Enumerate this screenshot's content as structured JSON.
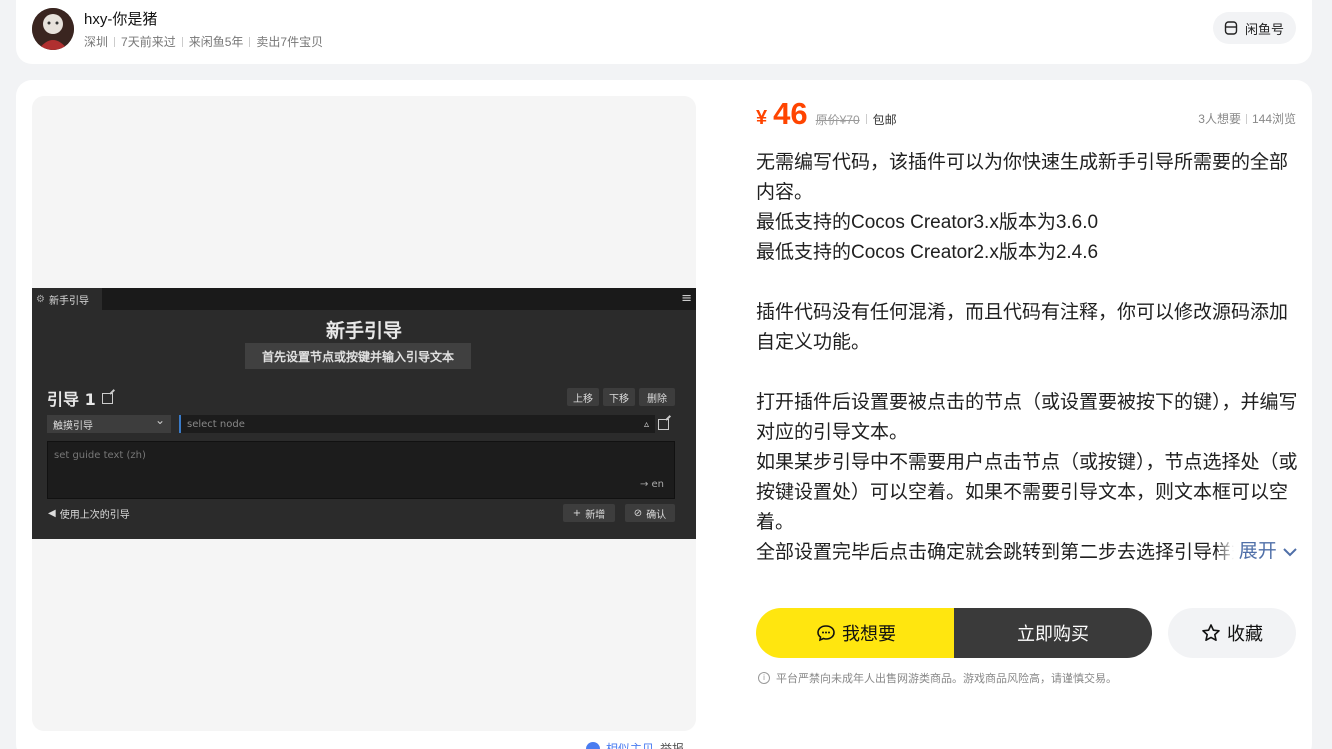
{
  "seller": {
    "name": "hxy-你是猪",
    "location": "深圳",
    "last_seen": "7天前来过",
    "member_since": "来闲鱼5年",
    "sold": "卖出7件宝贝",
    "xianyu_button": "闲鱼号"
  },
  "screenshot": {
    "tab": "新手引导",
    "title": "新手引导",
    "subtitle": "首先设置节点或按键并输入引导文本",
    "guide_label": "引导 1",
    "btn_up": "上移",
    "btn_down": "下移",
    "btn_delete": "删除",
    "select_value": "触摸引导",
    "node_placeholder": "select node",
    "text_placeholder": "set guide text (zh)",
    "lang_switch": "→ en",
    "use_last": "使用上次的引导",
    "btn_add": "新增",
    "btn_confirm": "确认"
  },
  "below_image": {
    "report": "相似主贝",
    "more": "举报"
  },
  "price": {
    "symbol": "¥",
    "value": "46",
    "original": "原价¥70",
    "shipping": "包邮"
  },
  "stats": {
    "wants": "3人想要",
    "views": "144浏览"
  },
  "description": [
    "无需编写代码，该插件可以为你快速生成新手引导所需要的全部内容。",
    "最低支持的Cocos Creator3.x版本为3.6.0",
    "最低支持的Cocos Creator2.x版本为2.4.6",
    "",
    "插件代码没有任何混淆，而且代码有注释，你可以修改源码添加自定义功能。",
    "",
    "打开插件后设置要被点击的节点（或设置要被按下的键），并编写对应的引导文本。",
    "如果某步引导中不需要用户点击节点（或按键），节点选择处（或按键设置处）可以空着。如果不需要引导文本，则文本框可以空着。",
    "全部设置完毕后点击确定就会跳转到第二步去选择引导样式。"
  ],
  "expand_label": "展开",
  "actions": {
    "want": "我想要",
    "buy": "立即购买",
    "favorite": "收藏"
  },
  "notice": "平台严禁向未成年人出售网游类商品。游戏商品风险高，请谨慎交易。",
  "colors": {
    "price": "#ff4400",
    "want_button": "#ffe60f",
    "buy_button": "#3a3a3a",
    "expand_link": "#4f6fa8"
  }
}
